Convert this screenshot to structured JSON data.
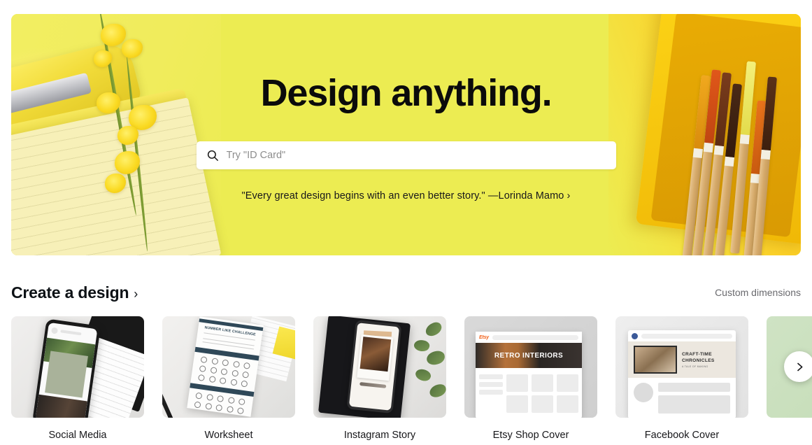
{
  "hero": {
    "title": "Design anything.",
    "search": {
      "placeholder": "Try \"ID Card\"",
      "value": "",
      "icon": "search-icon"
    },
    "tagline": "\"Every great design begins with an even better story.\" —Lorinda Mamo ›",
    "background_color": "#ecec52",
    "decor": {
      "left": "yellow stapler, lined notepad and yellow orchid flowers",
      "right": "colored pencils in a yellow tray with paper clips"
    }
  },
  "section": {
    "title": "Create a design",
    "chevron": "›",
    "custom_dimensions_label": "Custom dimensions"
  },
  "cards": [
    {
      "label": "Social Media",
      "thumb_kind": "t1",
      "thumb_desc": "phone on desk showing a plant social post next to a notebook"
    },
    {
      "label": "Worksheet",
      "thumb_kind": "t2",
      "thumb_desc": "printed worksheet on a desk with a pencil",
      "sheet_title": "NUMBER LIKE CHALLENGE",
      "sheet_band_1": "",
      "sheet_band_2": ""
    },
    {
      "label": "Instagram Story",
      "thumb_kind": "t3",
      "thumb_desc": "phone on a black notebook with eucalyptus leaves showing a polaroid story"
    },
    {
      "label": "Etsy Shop Cover",
      "thumb_kind": "t4",
      "thumb_desc": "etsy shop page mockup",
      "brand": "Etsy",
      "banner_text": "RETRO INTERIORS"
    },
    {
      "label": "Facebook Cover",
      "thumb_kind": "t5",
      "thumb_desc": "facebook page mockup with cover photo",
      "cover_title": "CRAFT-TIME",
      "cover_title_2": "CHRONICLES",
      "cover_sub": "A TALE OF MAKING"
    },
    {
      "label": "",
      "thumb_kind": "t6",
      "thumb_desc": "partially visible green card"
    }
  ],
  "carousel": {
    "next_icon": "chevron-right-icon",
    "next_label": "Next"
  },
  "colors": {
    "hero_yellow": "#ecec52",
    "page_background": "#ffffff",
    "text_primary": "#17171a",
    "text_muted": "#6a6a6e",
    "etsy_orange": "#f1641e"
  }
}
